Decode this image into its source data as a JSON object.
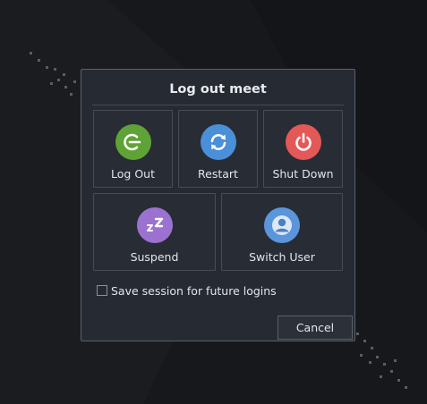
{
  "dialog": {
    "title": "Log out meet",
    "actions_row1": [
      {
        "label": "Log Out",
        "icon": "logout-icon",
        "color": "#5fa336"
      },
      {
        "label": "Restart",
        "icon": "restart-icon",
        "color": "#4a90d9"
      },
      {
        "label": "Shut Down",
        "icon": "power-icon",
        "color": "#e45858"
      }
    ],
    "actions_row2": [
      {
        "label": "Suspend",
        "icon": "sleep-icon",
        "color": "#9b72cf"
      },
      {
        "label": "Switch User",
        "icon": "user-icon",
        "color": "#5b95db"
      }
    ],
    "save_session_label": "Save session for future logins",
    "save_session_checked": false,
    "cancel_label": "Cancel"
  },
  "colors": {
    "background": "#17181b",
    "dialog_bg": "#262a33",
    "tile_border": "#474c56",
    "text": "#e3e5e9"
  }
}
